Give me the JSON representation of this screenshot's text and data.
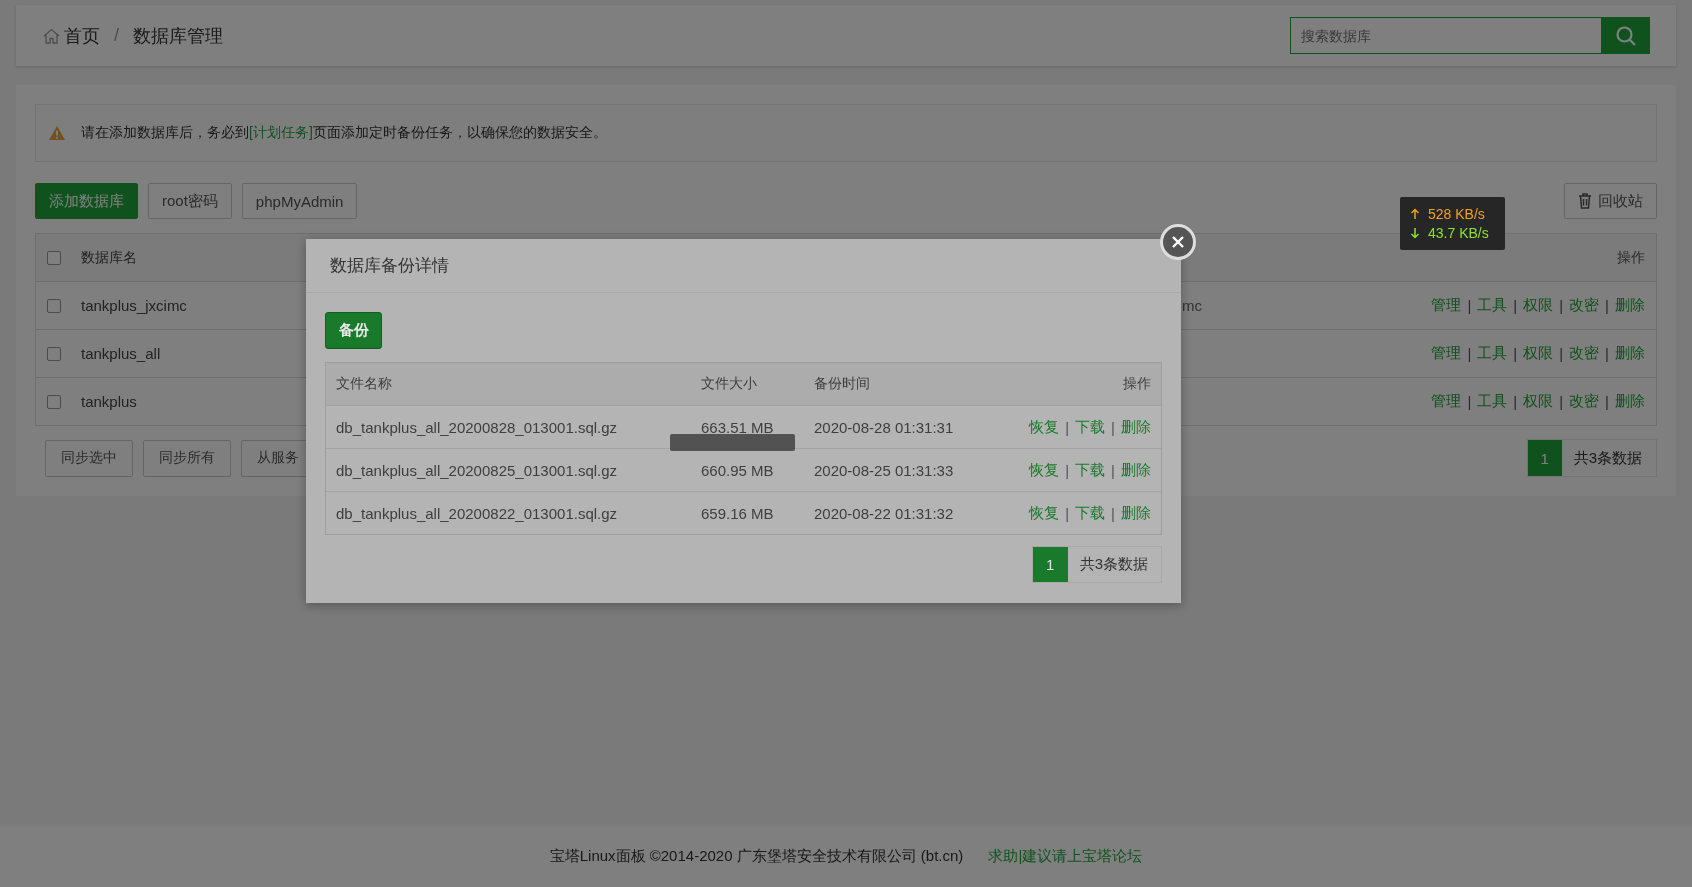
{
  "breadcrumb": {
    "items": [
      {
        "label": "首页"
      },
      {
        "label": "数据库管理"
      }
    ],
    "separator": "/"
  },
  "search": {
    "placeholder": "搜索数据库"
  },
  "alert": {
    "before": "请在添加数据库后，务必到",
    "link": "[计划任务]",
    "after": "页面添加定时备份任务，以确保您的数据安全。"
  },
  "toolbar": {
    "buttons": [
      {
        "label": "添加数据库",
        "kind": "primary"
      },
      {
        "label": "root密码",
        "kind": "default"
      },
      {
        "label": "phpMyAdmin",
        "kind": "default"
      }
    ],
    "recycle": "回收站"
  },
  "speed": {
    "up": "528 KB/s",
    "down": "43.7 KB/s"
  },
  "table": {
    "all_checked": false,
    "columns": [
      "数据库名",
      "操作"
    ],
    "separator": "|",
    "rows": [
      {
        "name": "tankplus_jxcimc",
        "checked": false,
        "column_2": "mc",
        "actions": [
          "管理",
          "工具",
          "权限",
          "改密",
          "删除"
        ]
      },
      {
        "name": "tankplus_all",
        "checked": false,
        "actions": [
          "管理",
          "工具",
          "权限",
          "改密",
          "删除"
        ]
      },
      {
        "name": "tankplus",
        "checked": false,
        "actions": [
          "管理",
          "工具",
          "权限",
          "改密",
          "删除"
        ]
      }
    ]
  },
  "bulk_buttons": [
    "同步选中",
    "同步所有",
    "从服务"
  ],
  "pagination": {
    "pages": [
      {
        "label": "1",
        "selected": true
      }
    ],
    "total": "共3条数据"
  },
  "modal": {
    "title": "数据库备份详情",
    "backup_button": "备份",
    "columns": [
      "文件名称",
      "文件大小",
      "备份时间",
      "操作"
    ],
    "separator": "|",
    "rows": [
      {
        "file": "db_tankplus_all_20200828_013001.sql.gz",
        "size": "663.51 MB",
        "time": "2020-08-28 01:31:31",
        "actions": [
          "恢复",
          "下载",
          "删除"
        ]
      },
      {
        "file": "db_tankplus_all_20200825_013001.sql.gz",
        "size": "660.95 MB",
        "time": "2020-08-25 01:31:33",
        "actions": [
          "恢复",
          "下载",
          "删除"
        ]
      },
      {
        "file": "db_tankplus_all_20200822_013001.sql.gz",
        "size": "659.16 MB",
        "time": "2020-08-22 01:31:32",
        "actions": [
          "恢复",
          "下载",
          "删除"
        ]
      }
    ],
    "pagination": {
      "pages": [
        {
          "label": "1",
          "selected": true
        }
      ],
      "total": "共3条数据"
    },
    "loading": true
  },
  "footer": {
    "text": "宝塔Linux面板 ©2014-2020 广东堡塔安全技术有限公司 (bt.cn)",
    "link": "求助|建议请上宝塔论坛"
  }
}
